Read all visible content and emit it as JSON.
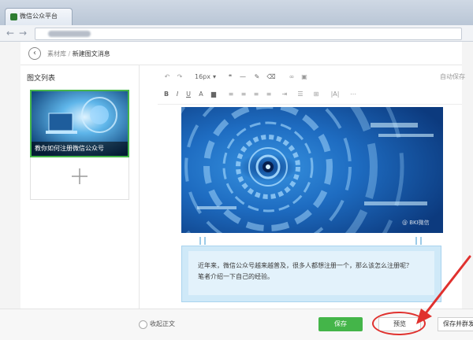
{
  "browser": {
    "tab_title": "微信公众平台",
    "back_glyph": "←",
    "forward_glyph": "→"
  },
  "header": {
    "back_glyph": "‹",
    "breadcrumb_root": "素材库",
    "breadcrumb_sep": " / ",
    "breadcrumb_current": "新建图文消息"
  },
  "left_panel": {
    "title": "图文列表",
    "card_caption": "教你如何注册微信公众号",
    "add_icon": "plus-icon"
  },
  "toolbar": {
    "undo": "↶",
    "redo": "↷",
    "font_size": "16px",
    "font_size_arrow": "▾",
    "quote": "❝",
    "hr": "—",
    "format_brush": "✎",
    "clear": "⌫",
    "link": "∞",
    "image": "▣",
    "autosave": "自动保存",
    "bold": "B",
    "italic": "I",
    "underline": "U",
    "font_color": "A",
    "bg_color": "▆",
    "align_left": "≡",
    "align_center": "≡",
    "align_right": "≡",
    "justify": "≡",
    "indent": "⇥",
    "list": "☰",
    "table": "⊞",
    "line_height": "|A|",
    "more": "⋯"
  },
  "editor": {
    "watermark": "@ BKI微信",
    "paragraph_line1": "近年来，微信公众号越来越普及，很多人都想注册一个，那么该怎么注册呢？",
    "paragraph_line2": "笔者介绍一下自己的经验。"
  },
  "bottom_bar": {
    "radio_label": "收起正文",
    "save_label": "保存",
    "preview_label": "预览",
    "save_send_label": "保存并群发"
  },
  "colors": {
    "accent_green": "#44b549",
    "annotation_red": "#e0312e",
    "paragraph_bg": "#cfe9f8"
  }
}
